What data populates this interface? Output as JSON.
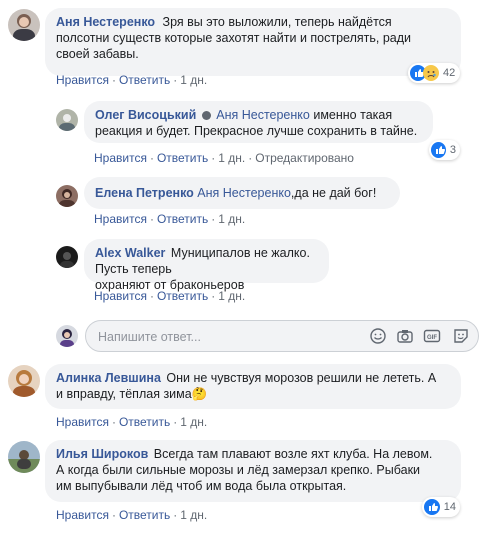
{
  "comments": [
    {
      "author": "Аня Нестеренко",
      "text": "Зря вы это выложили, теперь найдётся полсотни существ которые захотят найти и пострелять, ради своей забавы.",
      "line1": "Зря вы это выложили, теперь найдётся",
      "line2": "полсотни существ которые захотят найти и пострелять, ради",
      "line3": "своей забавы.",
      "like": "Нравится",
      "reply": "Ответить",
      "time": "1 дн.",
      "reactions_count": "42"
    },
    {
      "author": "Олег Висоцький",
      "mention": "Аня Нестеренко",
      "line1": "именно такая",
      "line2": "реакция и будет. Прекрасное лучше сохранить в тайне.",
      "like": "Нравится",
      "reply": "Ответить",
      "time": "1 дн.",
      "edited": "Отредактировано",
      "reactions_count": "3"
    },
    {
      "author": "Елена Петренко",
      "mention": "Аня Нестеренко",
      "line1": ",да не дай бог!",
      "like": "Нравится",
      "reply": "Ответить",
      "time": "1 дн."
    },
    {
      "author": "Alex Walker",
      "line1": "Муниципалов не жалко. Пусть теперь",
      "line2": "охраняют от браконьеров",
      "like": "Нравится",
      "reply": "Ответить",
      "time": "1 дн."
    },
    {
      "author": "Алинка Левшина",
      "line1": "Они не чувствуя морозов решили не лететь. А",
      "line2": "и вправду, тёплая зима",
      "emoji": "🤔",
      "like": "Нравится",
      "reply": "Ответить",
      "time": "1 дн."
    },
    {
      "author": "Илья Широков",
      "line1": "Всегда там плавают возле яхт клуба. На левом.",
      "line2": "А когда были сильные морозы и лёд замерзал крепко. Рыбаки",
      "line3": "им выпубывали лёд чтоб им вода была открытая.",
      "like": "Нравится",
      "reply": "Ответить",
      "time": "1 дн.",
      "reactions_count": "14"
    }
  ],
  "reply_box": {
    "placeholder": "Напишите ответ..."
  },
  "separator": "·",
  "icons": [
    "like-icon",
    "sad-icon",
    "smile-icon",
    "camera-icon",
    "gif-icon",
    "sticker-icon"
  ],
  "colors": {
    "link": "#385898",
    "bubble": "#f2f3f5",
    "meta": "#606770",
    "like_blue": "#1877f2"
  }
}
